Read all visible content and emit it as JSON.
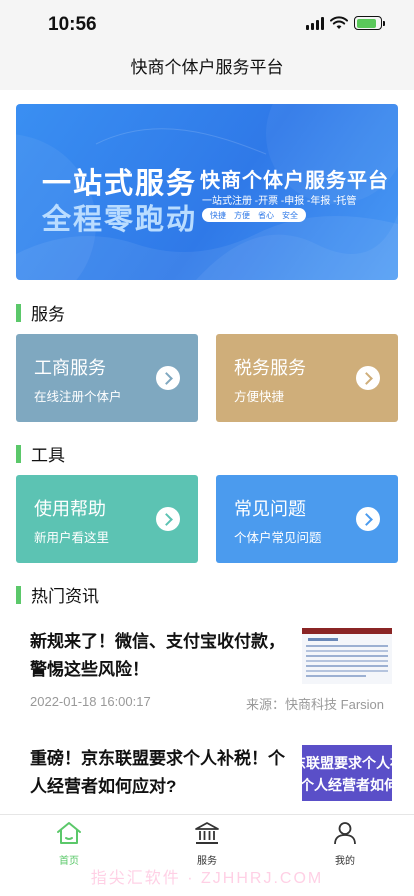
{
  "status_bar": {
    "time": "10:56"
  },
  "nav": {
    "title": "快商个体户服务平台"
  },
  "banner": {
    "left_line1": "一站式服务",
    "left_line2": "全程零跑动",
    "title": "快商个体户服务平台",
    "subtitle": "一站式注册 -开票 -申报 -年报 -托管",
    "tags": [
      "快捷",
      "方便",
      "省心",
      "安全"
    ]
  },
  "sections": {
    "service": "服务",
    "tools": "工具",
    "news": "热门资讯"
  },
  "service_cards": [
    {
      "title": "工商服务",
      "subtitle": "在线注册个体户",
      "color": "#7fa8c0"
    },
    {
      "title": "税务服务",
      "subtitle": "方便快捷",
      "color": "#cfae7a"
    }
  ],
  "tool_cards": [
    {
      "title": "使用帮助",
      "subtitle": "新用户看这里",
      "color": "#5cc3b3"
    },
    {
      "title": "常见问题",
      "subtitle": "个体户常见问题",
      "color": "#4b9bee"
    }
  ],
  "news": [
    {
      "title": "新规来了！微信、支付宝收付款，警惕这些风险！",
      "date": "2022-01-18 16:00:17",
      "source": "来源：快商科技 Farsion",
      "thumb": "document-thumbnail"
    },
    {
      "title": "重磅！京东联盟要求个人补税！个人经营者如何应对?",
      "thumb_text1": "东联盟要求个人补",
      "thumb_text2": "个人经营者如何应对",
      "thumb": "purple-text-thumbnail"
    }
  ],
  "tabbar": {
    "items": [
      {
        "label": "首页",
        "icon": "home-icon",
        "active": true
      },
      {
        "label": "服务",
        "icon": "bank-icon",
        "active": false
      },
      {
        "label": "我的",
        "icon": "user-icon",
        "active": false
      }
    ],
    "active_color": "#5bc86a"
  },
  "watermark": "指尖汇软件 · ZJHHRJ.COM"
}
